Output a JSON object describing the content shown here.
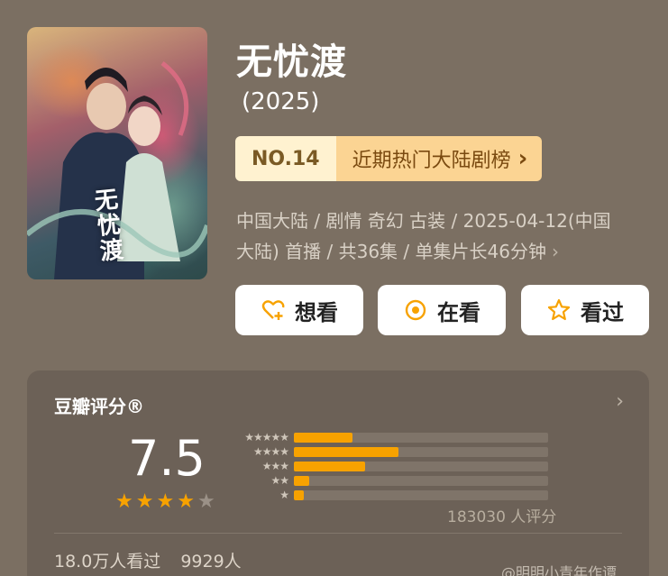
{
  "title": "无忧渡",
  "poster": {
    "title_text": "无忧渡"
  },
  "year": "(2025)",
  "rank": {
    "number": "NO.14",
    "label": "近期热门大陆剧榜",
    "chevron": "›"
  },
  "info": {
    "line1": "中国大陆 / 剧情 奇幻 古装 / 2025-04-12(中国",
    "line2": "大陆) 首播 / 共36集 / 单集片长46分钟",
    "chevron": "›"
  },
  "buttons": {
    "want": "想看",
    "watching": "在看",
    "watched": "看过"
  },
  "rating": {
    "header": "豆瓣评分®",
    "arrow": "›",
    "score": "7.5",
    "stars": 3.75,
    "distribution": [
      0.23,
      0.41,
      0.28,
      0.06,
      0.04
    ],
    "count": "183030 人评分",
    "watched": "18.0万人看过",
    "want": "9929人"
  },
  "watermark": "@明明小青年作谭",
  "colors": {
    "star": "#f7a200",
    "bar": "#f7a200",
    "rank_left": "#fff2d0",
    "rank_right": "#fbd493"
  },
  "icons": [
    "heart-plus-icon",
    "target-icon",
    "star-icon",
    "chevron-right-icon"
  ]
}
